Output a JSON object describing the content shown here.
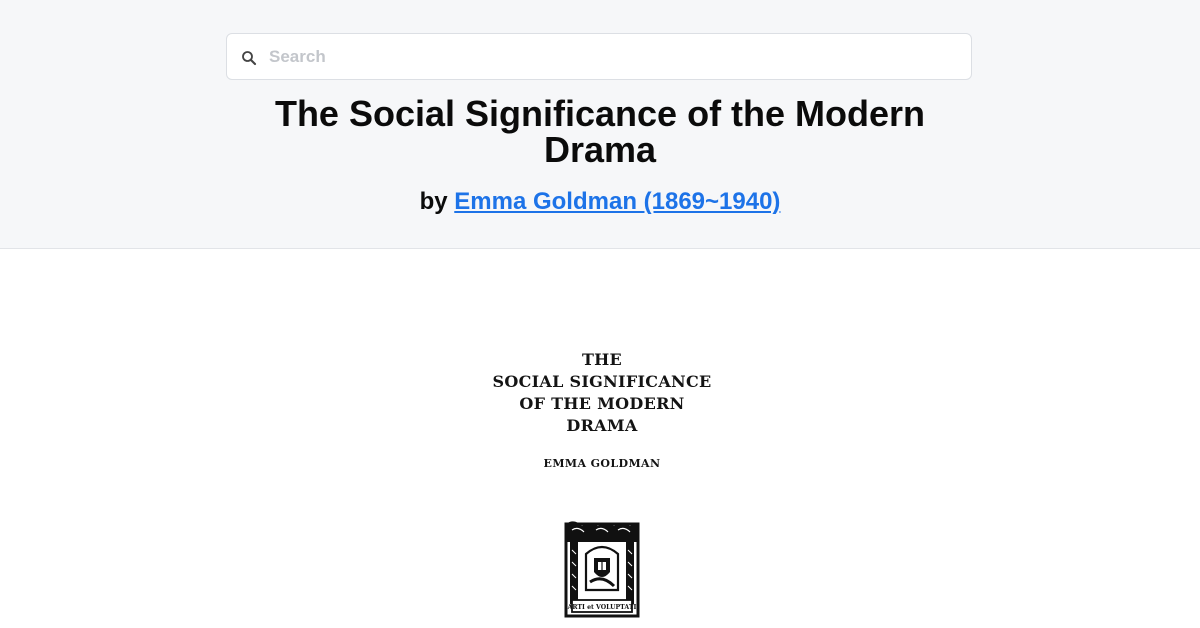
{
  "search": {
    "placeholder": "Search",
    "value": ""
  },
  "book": {
    "title": "The Social Significance of the Modern Drama",
    "by_label": "by",
    "author_link": "Emma Goldman (1869~1940)"
  },
  "cover": {
    "lines": [
      "THE",
      "SOCIAL SIGNIFICANCE",
      "OF THE MODERN",
      "DRAMA"
    ],
    "author": "EMMA GOLDMAN",
    "emblem_text": "ARTI et VOLUPTATI"
  },
  "colors": {
    "link": "#1d73e8",
    "header_bg": "#f6f7f9"
  },
  "icons": {
    "search": "search-icon"
  }
}
